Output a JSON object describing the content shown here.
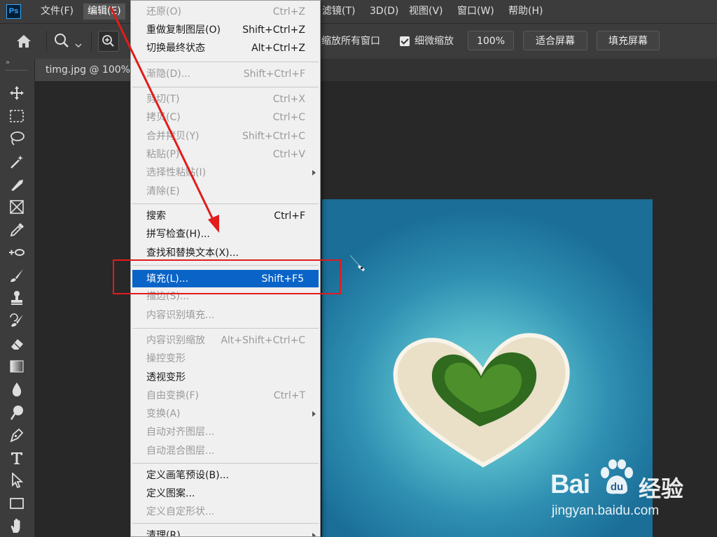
{
  "app": {
    "logo_text": "Ps"
  },
  "menubar": {
    "items": [
      {
        "label": "文件(F)"
      },
      {
        "label": "编辑(E)"
      },
      {
        "label": "滤镜(T)"
      },
      {
        "label": "3D(D)"
      },
      {
        "label": "视图(V)"
      },
      {
        "label": "窗口(W)"
      },
      {
        "label": "帮助(H)"
      }
    ]
  },
  "options_bar": {
    "zoom_all_windows": "缩放所有窗口",
    "scrubby_zoom_label": "细微缩放",
    "scrubby_zoom_checked": true,
    "zoom_value": "100%",
    "fit_screen": "适合屏幕",
    "fill_screen": "填充屏幕"
  },
  "document": {
    "tab_title": "timg.jpg @ 100%("
  },
  "edit_menu": {
    "groups": [
      [
        {
          "label": "还原(O)",
          "shortcut": "Ctrl+Z",
          "enabled": false
        },
        {
          "label": "重做复制图层(O)",
          "shortcut": "Shift+Ctrl+Z",
          "enabled": true
        },
        {
          "label": "切换最终状态",
          "shortcut": "Alt+Ctrl+Z",
          "enabled": true
        }
      ],
      [
        {
          "label": "渐隐(D)...",
          "shortcut": "Shift+Ctrl+F",
          "enabled": false
        }
      ],
      [
        {
          "label": "剪切(T)",
          "shortcut": "Ctrl+X",
          "enabled": false
        },
        {
          "label": "拷贝(C)",
          "shortcut": "Ctrl+C",
          "enabled": false
        },
        {
          "label": "合并拷贝(Y)",
          "shortcut": "Shift+Ctrl+C",
          "enabled": false
        },
        {
          "label": "粘贴(P)",
          "shortcut": "Ctrl+V",
          "enabled": false
        },
        {
          "label": "选择性粘贴(I)",
          "shortcut": "",
          "enabled": false,
          "submenu": true
        },
        {
          "label": "清除(E)",
          "shortcut": "",
          "enabled": false
        }
      ],
      [
        {
          "label": "搜索",
          "shortcut": "Ctrl+F",
          "enabled": true
        },
        {
          "label": "拼写检查(H)...",
          "shortcut": "",
          "enabled": true
        },
        {
          "label": "查找和替换文本(X)...",
          "shortcut": "",
          "enabled": true
        }
      ],
      [
        {
          "label": "填充(L)...",
          "shortcut": "Shift+F5",
          "enabled": true,
          "highlighted": true
        },
        {
          "label": "描边(S)...",
          "shortcut": "",
          "enabled": false
        },
        {
          "label": "内容识别填充...",
          "shortcut": "",
          "enabled": false
        }
      ],
      [
        {
          "label": "内容识别缩放",
          "shortcut": "Alt+Shift+Ctrl+C",
          "enabled": false
        },
        {
          "label": "操控变形",
          "shortcut": "",
          "enabled": false
        },
        {
          "label": "透视变形",
          "shortcut": "",
          "enabled": true
        },
        {
          "label": "自由变换(F)",
          "shortcut": "Ctrl+T",
          "enabled": false
        },
        {
          "label": "变换(A)",
          "shortcut": "",
          "enabled": false,
          "submenu": true
        },
        {
          "label": "自动对齐图层...",
          "shortcut": "",
          "enabled": false
        },
        {
          "label": "自动混合图层...",
          "shortcut": "",
          "enabled": false
        }
      ],
      [
        {
          "label": "定义画笔预设(B)...",
          "shortcut": "",
          "enabled": true
        },
        {
          "label": "定义图案...",
          "shortcut": "",
          "enabled": true
        },
        {
          "label": "定义自定形状...",
          "shortcut": "",
          "enabled": false
        }
      ],
      [
        {
          "label": "清理(R)",
          "shortcut": "",
          "enabled": true,
          "submenu": true
        }
      ]
    ]
  },
  "toolbar": {
    "tools": [
      "move-tool",
      "marquee-tool",
      "lasso-tool",
      "magic-wand-tool",
      "slice-tool",
      "frame-tool",
      "eyedropper-tool",
      "spot-healing-tool",
      "brush-tool",
      "stamp-tool",
      "history-brush-tool",
      "eraser-tool",
      "gradient-tool",
      "blur-tool",
      "dodge-tool",
      "pen-tool",
      "type-tool",
      "path-selection-tool",
      "rectangle-tool",
      "hand-tool"
    ]
  },
  "watermark": {
    "brand": "Bai",
    "brand_cn": "经验",
    "url": "jingyan.baidu.com"
  },
  "colors": {
    "highlight": "#0a64c8",
    "annotation": "#e21b1b",
    "ui_bg": "#3c3c3c"
  }
}
